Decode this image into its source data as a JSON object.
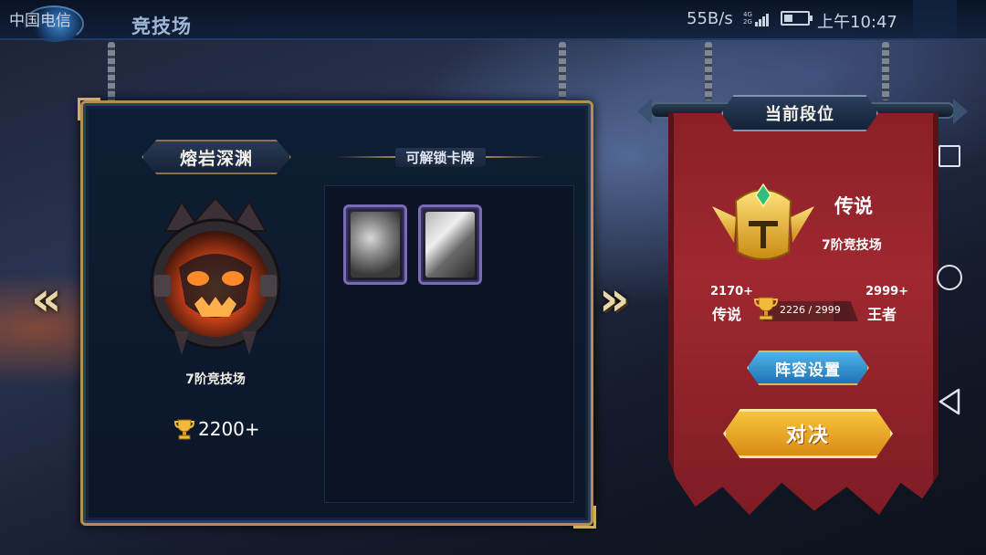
{
  "status_bar": {
    "carrier": "中国电信",
    "network_speed": "55B/s",
    "network_type": "4G 2G",
    "clock": "上午10:47"
  },
  "header": {
    "title": "竞技场"
  },
  "arena": {
    "name": "熔岩深渊",
    "tier_label": "7阶竞技场",
    "trophy_requirement": "2200+",
    "unlockable_cards_label": "可解锁卡牌",
    "unlockable_cards": [
      {
        "icon": "axe-card-art"
      },
      {
        "icon": "meteor-card-art"
      }
    ]
  },
  "rank": {
    "title": "当前段位",
    "name": "传说",
    "tier_label": "7阶竞技场",
    "lower_bound_score": "2170+",
    "lower_bound_name": "传说",
    "upper_bound_score": "2999+",
    "upper_bound_name": "王者",
    "progress_text": "2226 / 2999",
    "progress_fraction": 0.742
  },
  "buttons": {
    "lineup": "阵容设置",
    "battle": "对决"
  },
  "colors": {
    "banner_red": "#a02830",
    "gold": "#d0ac62",
    "lineup_blue": "#1f74b6",
    "battle_gold": "#f7c43e"
  }
}
